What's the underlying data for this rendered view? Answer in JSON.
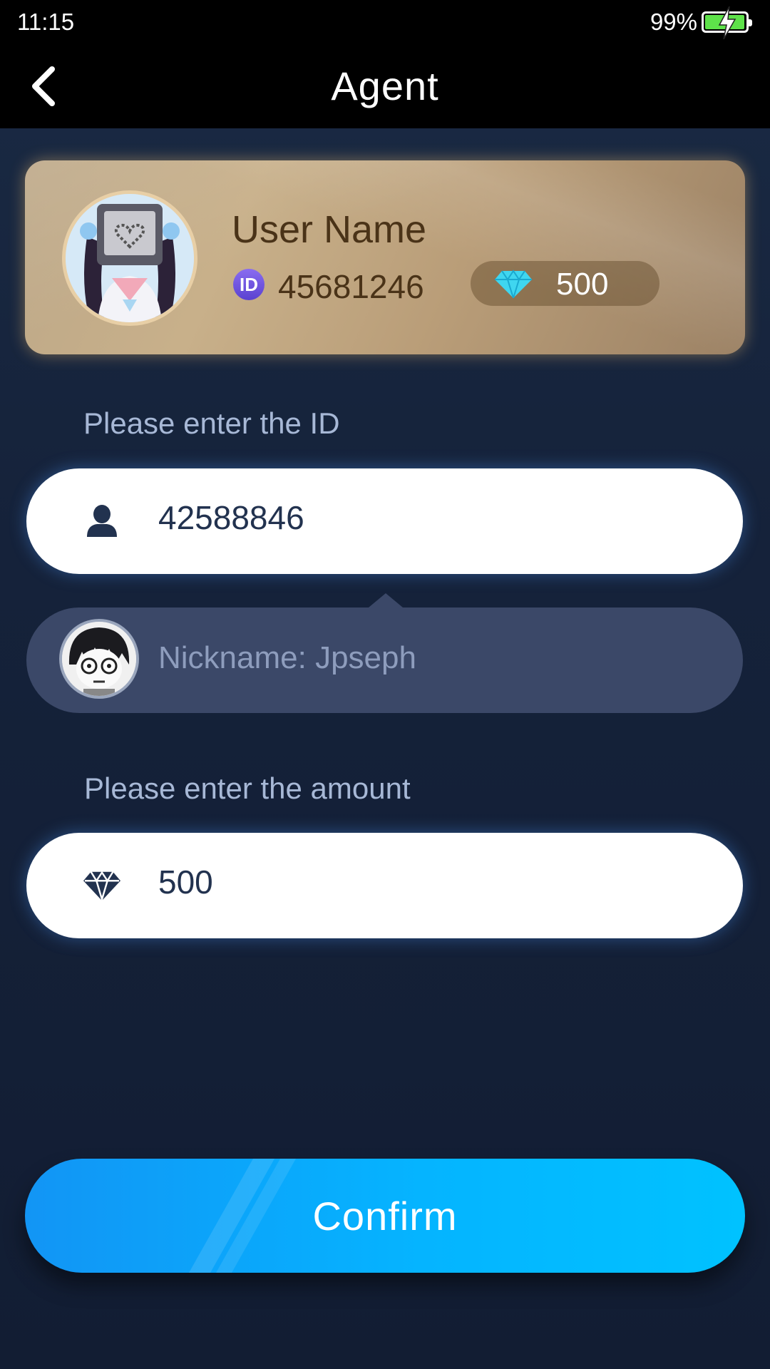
{
  "status_bar": {
    "time": "11:15",
    "battery_percent": "99%",
    "battery_level": 0.99,
    "battery_charging": true
  },
  "navbar": {
    "title": "Agent",
    "back_icon": "chevron-left-icon"
  },
  "profile": {
    "username": "User Name",
    "id_badge": "ID",
    "user_id": "45681246",
    "diamond_balance": "500",
    "diamond_icon": "diamond-icon"
  },
  "form": {
    "id_label": "Please enter the ID",
    "id_value": "42588846",
    "id_icon": "user-icon",
    "nickname_text": "Nickname: Jpseph",
    "amount_label": "Please enter the amount",
    "amount_value": "500",
    "amount_icon": "diamond-icon"
  },
  "actions": {
    "confirm_label": "Confirm"
  },
  "colors": {
    "nav_bg": "#000000",
    "page_bg": "#16223a",
    "card_gold": "#c8b08a",
    "accent_blue": "#05b4ff",
    "label_text": "#a7b8d6",
    "battery_green": "#5ee24a"
  }
}
